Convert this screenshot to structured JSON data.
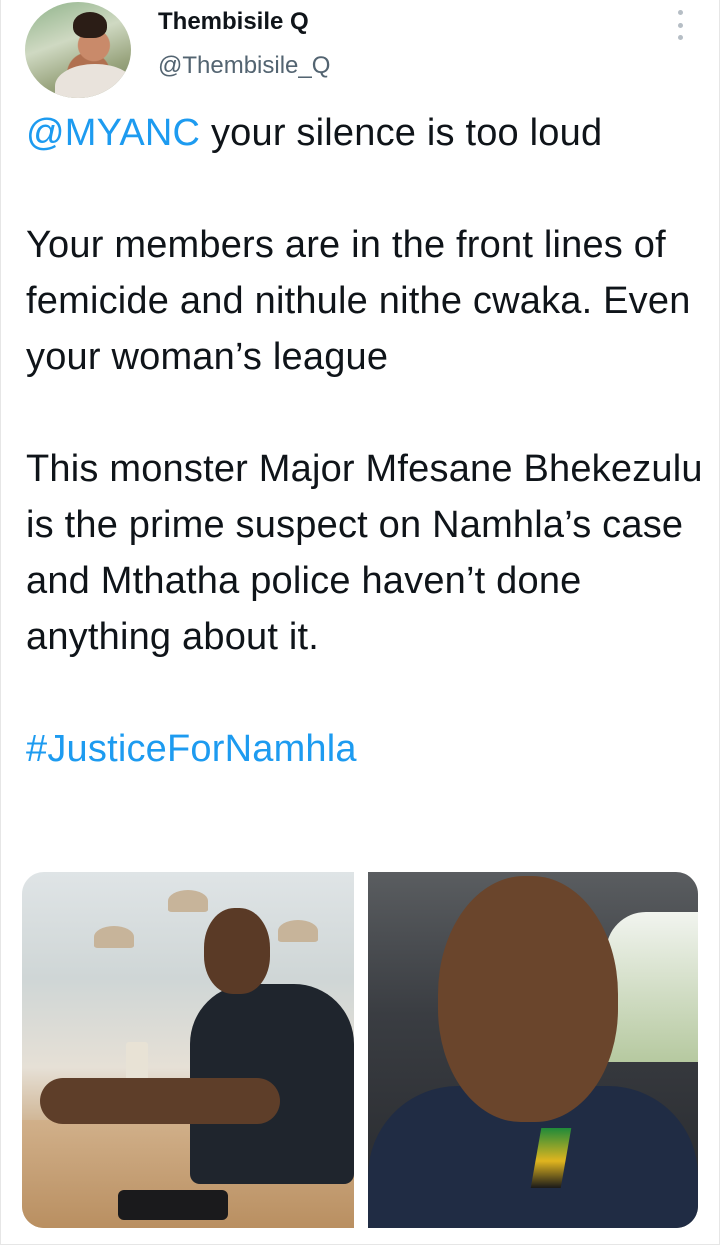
{
  "tweet": {
    "author": {
      "display_name": "Thembisile Q",
      "handle": "@Thembisile_Q"
    },
    "mention": "@MYANC",
    "line1_rest": " your silence is too loud",
    "paragraph2": "Your members are in the front lines of femicide and nithule nithe cwaka. Even your woman’s league",
    "paragraph3": "This monster Major Mfesane Bhekezulu is the prime suspect on Namhla’s case and Mthatha police haven’t done anything about it.",
    "hashtag": "#JusticeForNamhla",
    "photo_count": 2
  },
  "icons": {
    "more": "more-vertical-icon"
  },
  "colors": {
    "link": "#1d9bf0",
    "text": "#0f1419",
    "secondary": "#536471"
  }
}
